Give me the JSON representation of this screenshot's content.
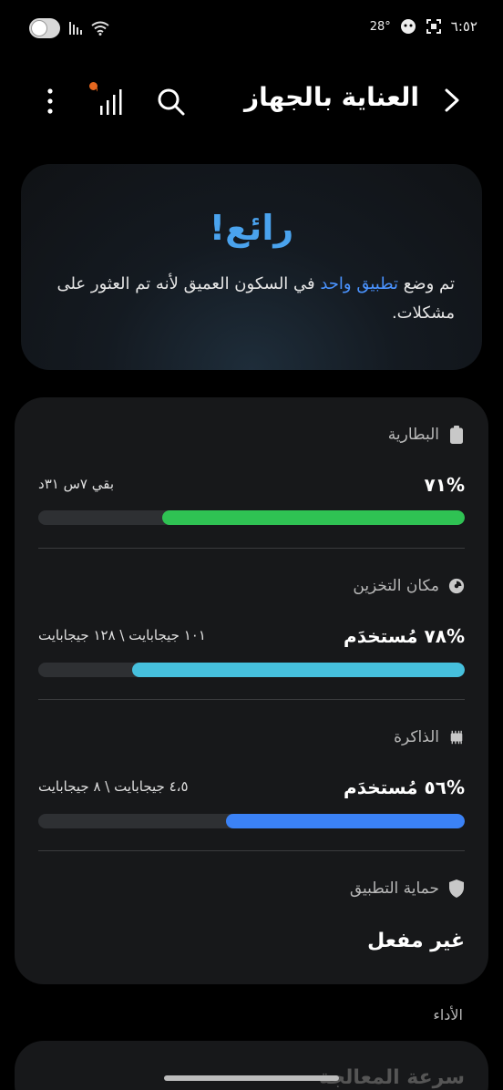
{
  "status_bar": {
    "time": "٦:٥٢",
    "temperature": "28°"
  },
  "header": {
    "title": "العناية بالجهاز"
  },
  "hero": {
    "title": "رائع!",
    "text_before": "تم وضع ",
    "link": "تطبيق واحد",
    "text_after": " في السكون العميق لأنه تم العثور على مشكلات."
  },
  "battery": {
    "label": "البطارية",
    "value": "%٧١",
    "remaining": "بقي ٧س ٣١د",
    "percent": 71,
    "color": "#2fc253"
  },
  "storage": {
    "label": "مكان التخزين",
    "value": "%٧٨ مُستخدَم",
    "detail": "١٠١ جيجابايت \\ ١٢٨ جيجابايت",
    "percent": 78,
    "color": "#46c0dd"
  },
  "memory": {
    "label": "الذاكرة",
    "value": "%٥٦ مُستخدَم",
    "detail": "٤،٥ جيجابايت \\ ٨ جيجابايت",
    "percent": 56,
    "color": "#3b82f6"
  },
  "app_protection": {
    "label": "حماية التطبيق",
    "value": "غير مفعل"
  },
  "performance": {
    "label": "الأداء",
    "card_title": "سرعة المعالجة"
  }
}
